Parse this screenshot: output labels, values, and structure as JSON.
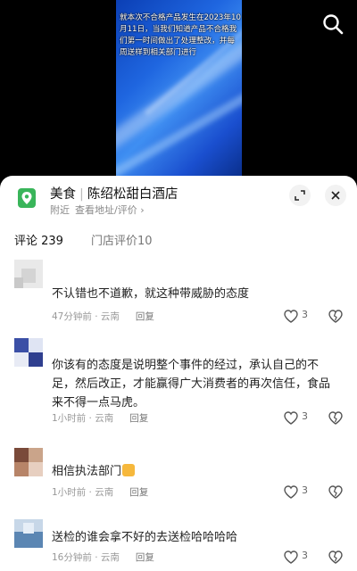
{
  "video": {
    "caption": "就本次不合格产品发生在2023年10月11日，当我们知道产品不合格我们第一时间做出了处理整改，并每周送样到相关部门进行"
  },
  "store": {
    "category": "美食",
    "separator": "|",
    "name": "陈绍松甜白酒店",
    "nearby": "附近",
    "address_link": "查看地址/评价 ›"
  },
  "tabs": {
    "comments": "评论 239",
    "store_reviews": "门店评价10"
  },
  "comments": [
    {
      "text": "不认错也不道歉，就这种带威胁的态度",
      "time": "47分钟前 · 云南",
      "reply": "回复",
      "likes": "3"
    },
    {
      "text": "你该有的态度是说明整个事件的经过，承认自己的不足，然后改正，才能赢得广大消费者的再次信任，食品来不得一点马虎。",
      "time": "1小时前 · 云南",
      "reply": "回复",
      "likes": "3"
    },
    {
      "text": "相信执法部门",
      "time": "1小时前 · 云南",
      "reply": "回复",
      "likes": "3"
    },
    {
      "text": "送检的谁会拿不好的去送检哈哈哈哈",
      "time": "16分钟前 · 云南",
      "reply": "回复",
      "likes": "3"
    }
  ],
  "colors": {
    "brand_green": "#39b55a",
    "video_blue": "#1f66e0"
  }
}
